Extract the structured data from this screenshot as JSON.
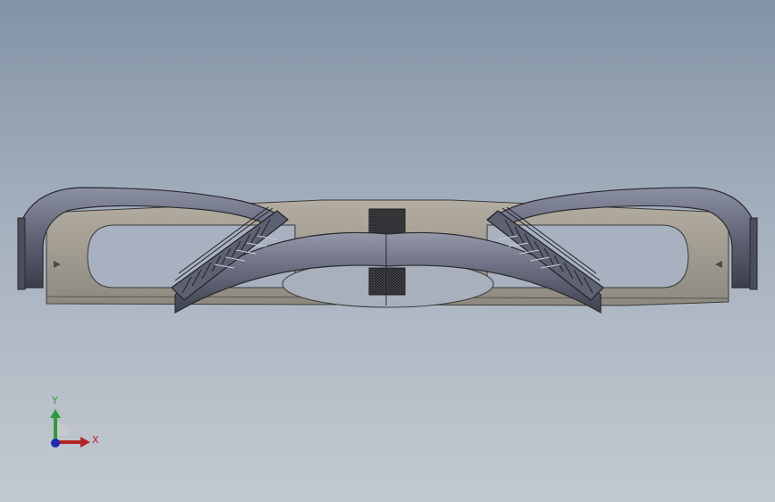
{
  "viewport": {
    "background_top": "#8393a6",
    "background_bottom": "#c3c9d0"
  },
  "model": {
    "description_icon": "gripper-part-3d-model",
    "plate_color": "#a39f94",
    "body_color": "#5e6273",
    "hatch_color": "#2a2a30"
  },
  "triad": {
    "y_label": "Y",
    "x_label": "X",
    "y_color": "#2e9b3a",
    "x_color": "#b42424",
    "z_color": "#1c2bb0"
  }
}
